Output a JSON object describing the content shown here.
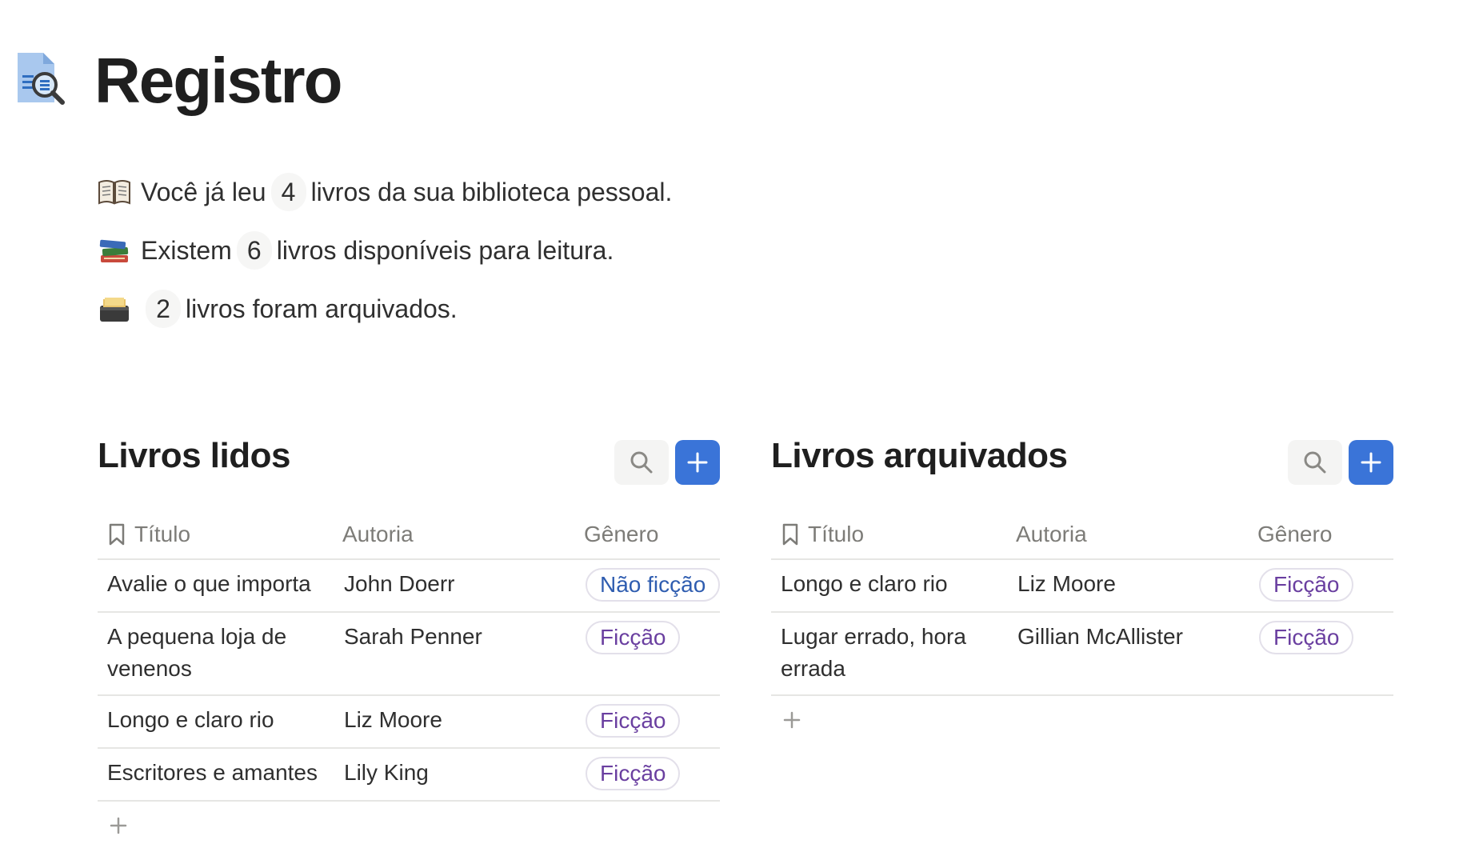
{
  "page": {
    "title": "Registro",
    "icon": "document-magnifier-icon"
  },
  "stats": [
    {
      "emoji": "open-book-icon",
      "before": "Você já leu",
      "count": "4",
      "after": "livros da sua biblioteca pessoal."
    },
    {
      "emoji": "books-stack-icon",
      "before": "Existem",
      "count": "6",
      "after": "livros disponíveis para leitura."
    },
    {
      "emoji": "card-file-box-icon",
      "before": "",
      "count": "2",
      "after": "livros foram arquivados."
    }
  ],
  "read_books": {
    "title": "Livros lidos",
    "columns": {
      "title": "Título",
      "author": "Autoria",
      "genre": "Gênero"
    },
    "rows": [
      {
        "title": "Avalie o que importa",
        "author": "John Doerr",
        "genre": "Não ficção"
      },
      {
        "title": "A pequena loja de venenos",
        "author": "Sarah Penner",
        "genre": "Ficção"
      },
      {
        "title": "Longo e claro rio",
        "author": "Liz Moore",
        "genre": "Ficção"
      },
      {
        "title": "Escritores e amantes",
        "author": "Lily King",
        "genre": "Ficção"
      }
    ]
  },
  "archived_books": {
    "title": "Livros arquivados",
    "columns": {
      "title": "Título",
      "author": "Autoria",
      "genre": "Gênero"
    },
    "rows": [
      {
        "title": "Longo e claro rio",
        "author": "Liz Moore",
        "genre": "Ficção"
      },
      {
        "title": "Lugar errado, hora errada",
        "author": "Gillian McAllister",
        "genre": "Ficção"
      }
    ]
  },
  "colors": {
    "accent": "#3a74d8",
    "tag_text": "#6a3fa0",
    "border": "#e6e6e4"
  }
}
